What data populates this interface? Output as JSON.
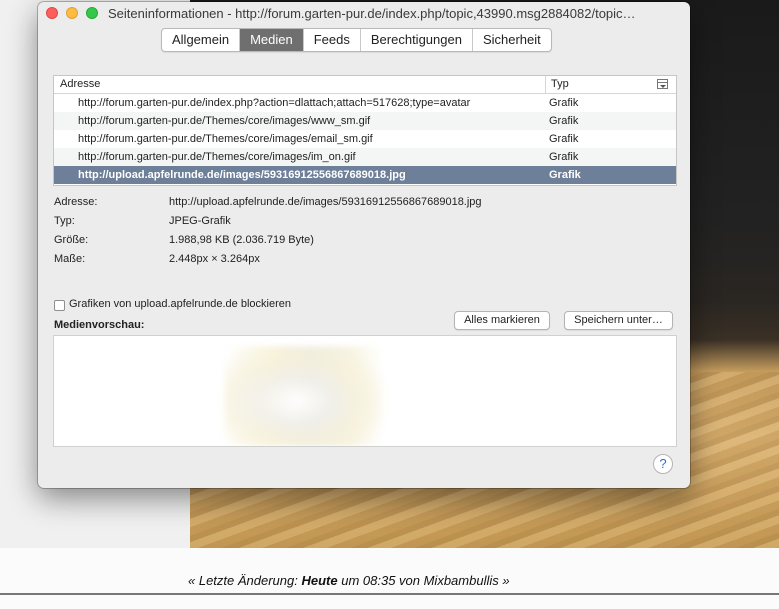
{
  "window": {
    "title": "Seiteninformationen - http://forum.garten-pur.de/index.php/topic,43990.msg2884082/topic…"
  },
  "tabs": [
    {
      "label": "Allgemein"
    },
    {
      "label": "Medien"
    },
    {
      "label": "Feeds"
    },
    {
      "label": "Berechtigungen"
    },
    {
      "label": "Sicherheit"
    }
  ],
  "active_tab": "Medien",
  "table": {
    "col_address": "Adresse",
    "col_type": "Typ",
    "rows": [
      {
        "address": "http://forum.garten-pur.de/index.php?action=dlattach;attach=517628;type=avatar",
        "type": "Grafik"
      },
      {
        "address": "http://forum.garten-pur.de/Themes/core/images/www_sm.gif",
        "type": "Grafik"
      },
      {
        "address": "http://forum.garten-pur.de/Themes/core/images/email_sm.gif",
        "type": "Grafik"
      },
      {
        "address": "http://forum.garten-pur.de/Themes/core/images/im_on.gif",
        "type": "Grafik"
      },
      {
        "address": "http://upload.apfelrunde.de/images/59316912556867689018.jpg",
        "type": "Grafik"
      }
    ]
  },
  "details": {
    "address_label": "Adresse:",
    "address_value": "http://upload.apfelrunde.de/images/59316912556867689018.jpg",
    "type_label": "Typ:",
    "type_value": "JPEG-Grafik",
    "size_label": "Größe:",
    "size_value": "1.988,98 KB (2.036.719 Byte)",
    "dims_label": "Maße:",
    "dims_value": "2.448px × 3.264px"
  },
  "block_checkbox_label": "Grafiken von upload.apfelrunde.de blockieren",
  "preview_label": "Medienvorschau:",
  "buttons": {
    "select_all": "Alles markieren",
    "save_as": "Speichern unter…",
    "help": "?"
  },
  "background": {
    "footer_prefix": "« Letzte Änderung: ",
    "footer_bold": "Heute",
    "footer_suffix": " um 08:35 von Mixbambullis »"
  }
}
